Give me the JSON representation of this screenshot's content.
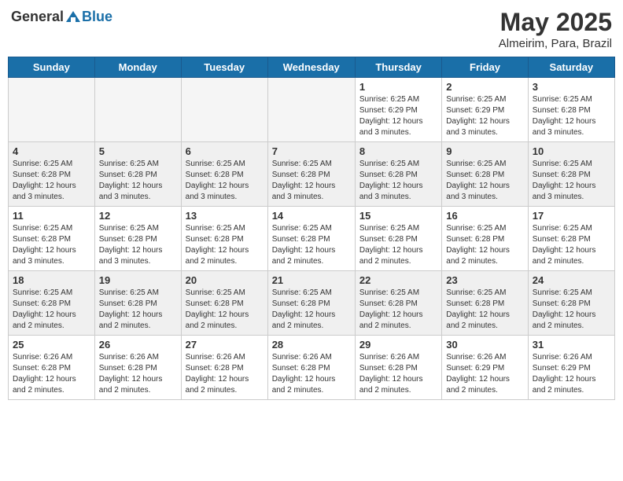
{
  "header": {
    "logo_general": "General",
    "logo_blue": "Blue",
    "month": "May 2025",
    "location": "Almeirim, Para, Brazil"
  },
  "days_of_week": [
    "Sunday",
    "Monday",
    "Tuesday",
    "Wednesday",
    "Thursday",
    "Friday",
    "Saturday"
  ],
  "weeks": [
    {
      "shaded": false,
      "days": [
        {
          "num": "",
          "info": "",
          "empty": true
        },
        {
          "num": "",
          "info": "",
          "empty": true
        },
        {
          "num": "",
          "info": "",
          "empty": true
        },
        {
          "num": "",
          "info": "",
          "empty": true
        },
        {
          "num": "1",
          "info": "Sunrise: 6:25 AM\nSunset: 6:29 PM\nDaylight: 12 hours\nand 3 minutes.",
          "empty": false
        },
        {
          "num": "2",
          "info": "Sunrise: 6:25 AM\nSunset: 6:29 PM\nDaylight: 12 hours\nand 3 minutes.",
          "empty": false
        },
        {
          "num": "3",
          "info": "Sunrise: 6:25 AM\nSunset: 6:28 PM\nDaylight: 12 hours\nand 3 minutes.",
          "empty": false
        }
      ]
    },
    {
      "shaded": true,
      "days": [
        {
          "num": "4",
          "info": "Sunrise: 6:25 AM\nSunset: 6:28 PM\nDaylight: 12 hours\nand 3 minutes.",
          "empty": false
        },
        {
          "num": "5",
          "info": "Sunrise: 6:25 AM\nSunset: 6:28 PM\nDaylight: 12 hours\nand 3 minutes.",
          "empty": false
        },
        {
          "num": "6",
          "info": "Sunrise: 6:25 AM\nSunset: 6:28 PM\nDaylight: 12 hours\nand 3 minutes.",
          "empty": false
        },
        {
          "num": "7",
          "info": "Sunrise: 6:25 AM\nSunset: 6:28 PM\nDaylight: 12 hours\nand 3 minutes.",
          "empty": false
        },
        {
          "num": "8",
          "info": "Sunrise: 6:25 AM\nSunset: 6:28 PM\nDaylight: 12 hours\nand 3 minutes.",
          "empty": false
        },
        {
          "num": "9",
          "info": "Sunrise: 6:25 AM\nSunset: 6:28 PM\nDaylight: 12 hours\nand 3 minutes.",
          "empty": false
        },
        {
          "num": "10",
          "info": "Sunrise: 6:25 AM\nSunset: 6:28 PM\nDaylight: 12 hours\nand 3 minutes.",
          "empty": false
        }
      ]
    },
    {
      "shaded": false,
      "days": [
        {
          "num": "11",
          "info": "Sunrise: 6:25 AM\nSunset: 6:28 PM\nDaylight: 12 hours\nand 3 minutes.",
          "empty": false
        },
        {
          "num": "12",
          "info": "Sunrise: 6:25 AM\nSunset: 6:28 PM\nDaylight: 12 hours\nand 3 minutes.",
          "empty": false
        },
        {
          "num": "13",
          "info": "Sunrise: 6:25 AM\nSunset: 6:28 PM\nDaylight: 12 hours\nand 2 minutes.",
          "empty": false
        },
        {
          "num": "14",
          "info": "Sunrise: 6:25 AM\nSunset: 6:28 PM\nDaylight: 12 hours\nand 2 minutes.",
          "empty": false
        },
        {
          "num": "15",
          "info": "Sunrise: 6:25 AM\nSunset: 6:28 PM\nDaylight: 12 hours\nand 2 minutes.",
          "empty": false
        },
        {
          "num": "16",
          "info": "Sunrise: 6:25 AM\nSunset: 6:28 PM\nDaylight: 12 hours\nand 2 minutes.",
          "empty": false
        },
        {
          "num": "17",
          "info": "Sunrise: 6:25 AM\nSunset: 6:28 PM\nDaylight: 12 hours\nand 2 minutes.",
          "empty": false
        }
      ]
    },
    {
      "shaded": true,
      "days": [
        {
          "num": "18",
          "info": "Sunrise: 6:25 AM\nSunset: 6:28 PM\nDaylight: 12 hours\nand 2 minutes.",
          "empty": false
        },
        {
          "num": "19",
          "info": "Sunrise: 6:25 AM\nSunset: 6:28 PM\nDaylight: 12 hours\nand 2 minutes.",
          "empty": false
        },
        {
          "num": "20",
          "info": "Sunrise: 6:25 AM\nSunset: 6:28 PM\nDaylight: 12 hours\nand 2 minutes.",
          "empty": false
        },
        {
          "num": "21",
          "info": "Sunrise: 6:25 AM\nSunset: 6:28 PM\nDaylight: 12 hours\nand 2 minutes.",
          "empty": false
        },
        {
          "num": "22",
          "info": "Sunrise: 6:25 AM\nSunset: 6:28 PM\nDaylight: 12 hours\nand 2 minutes.",
          "empty": false
        },
        {
          "num": "23",
          "info": "Sunrise: 6:25 AM\nSunset: 6:28 PM\nDaylight: 12 hours\nand 2 minutes.",
          "empty": false
        },
        {
          "num": "24",
          "info": "Sunrise: 6:25 AM\nSunset: 6:28 PM\nDaylight: 12 hours\nand 2 minutes.",
          "empty": false
        }
      ]
    },
    {
      "shaded": false,
      "days": [
        {
          "num": "25",
          "info": "Sunrise: 6:26 AM\nSunset: 6:28 PM\nDaylight: 12 hours\nand 2 minutes.",
          "empty": false
        },
        {
          "num": "26",
          "info": "Sunrise: 6:26 AM\nSunset: 6:28 PM\nDaylight: 12 hours\nand 2 minutes.",
          "empty": false
        },
        {
          "num": "27",
          "info": "Sunrise: 6:26 AM\nSunset: 6:28 PM\nDaylight: 12 hours\nand 2 minutes.",
          "empty": false
        },
        {
          "num": "28",
          "info": "Sunrise: 6:26 AM\nSunset: 6:28 PM\nDaylight: 12 hours\nand 2 minutes.",
          "empty": false
        },
        {
          "num": "29",
          "info": "Sunrise: 6:26 AM\nSunset: 6:28 PM\nDaylight: 12 hours\nand 2 minutes.",
          "empty": false
        },
        {
          "num": "30",
          "info": "Sunrise: 6:26 AM\nSunset: 6:29 PM\nDaylight: 12 hours\nand 2 minutes.",
          "empty": false
        },
        {
          "num": "31",
          "info": "Sunrise: 6:26 AM\nSunset: 6:29 PM\nDaylight: 12 hours\nand 2 minutes.",
          "empty": false
        }
      ]
    }
  ]
}
